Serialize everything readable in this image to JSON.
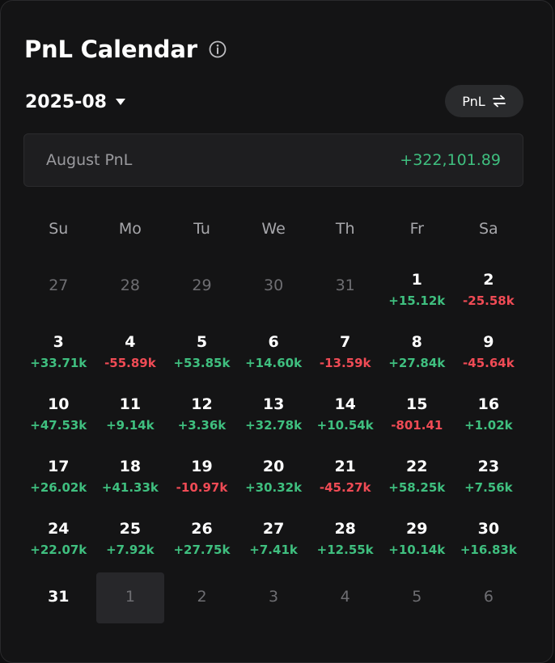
{
  "header": {
    "title": "PnL Calendar",
    "info_icon": "info-icon"
  },
  "month_select": {
    "label": "2025-08",
    "icon": "caret-down-icon"
  },
  "toggle": {
    "label": "PnL",
    "icon": "swap-icon"
  },
  "summary": {
    "label": "August PnL",
    "value": "+322,101.89"
  },
  "colors": {
    "positive": "#3fbf7f",
    "negative": "#f04b55",
    "background": "#141415"
  },
  "weekdays": [
    "Su",
    "Mo",
    "Tu",
    "We",
    "Th",
    "Fr",
    "Sa"
  ],
  "weeks": [
    [
      {
        "day": "27",
        "outside": true
      },
      {
        "day": "28",
        "outside": true
      },
      {
        "day": "29",
        "outside": true
      },
      {
        "day": "30",
        "outside": true
      },
      {
        "day": "31",
        "outside": true
      },
      {
        "day": "1",
        "pnl": "+15.12k",
        "sign": "pos"
      },
      {
        "day": "2",
        "pnl": "-25.58k",
        "sign": "neg"
      }
    ],
    [
      {
        "day": "3",
        "pnl": "+33.71k",
        "sign": "pos"
      },
      {
        "day": "4",
        "pnl": "-55.89k",
        "sign": "neg"
      },
      {
        "day": "5",
        "pnl": "+53.85k",
        "sign": "pos"
      },
      {
        "day": "6",
        "pnl": "+14.60k",
        "sign": "pos"
      },
      {
        "day": "7",
        "pnl": "-13.59k",
        "sign": "neg"
      },
      {
        "day": "8",
        "pnl": "+27.84k",
        "sign": "pos"
      },
      {
        "day": "9",
        "pnl": "-45.64k",
        "sign": "neg"
      }
    ],
    [
      {
        "day": "10",
        "pnl": "+47.53k",
        "sign": "pos"
      },
      {
        "day": "11",
        "pnl": "+9.14k",
        "sign": "pos"
      },
      {
        "day": "12",
        "pnl": "+3.36k",
        "sign": "pos"
      },
      {
        "day": "13",
        "pnl": "+32.78k",
        "sign": "pos"
      },
      {
        "day": "14",
        "pnl": "+10.54k",
        "sign": "pos"
      },
      {
        "day": "15",
        "pnl": "-801.41",
        "sign": "neg"
      },
      {
        "day": "16",
        "pnl": "+1.02k",
        "sign": "pos"
      }
    ],
    [
      {
        "day": "17",
        "pnl": "+26.02k",
        "sign": "pos"
      },
      {
        "day": "18",
        "pnl": "+41.33k",
        "sign": "pos"
      },
      {
        "day": "19",
        "pnl": "-10.97k",
        "sign": "neg"
      },
      {
        "day": "20",
        "pnl": "+30.32k",
        "sign": "pos"
      },
      {
        "day": "21",
        "pnl": "-45.27k",
        "sign": "neg"
      },
      {
        "day": "22",
        "pnl": "+58.25k",
        "sign": "pos"
      },
      {
        "day": "23",
        "pnl": "+7.56k",
        "sign": "pos"
      }
    ],
    [
      {
        "day": "24",
        "pnl": "+22.07k",
        "sign": "pos"
      },
      {
        "day": "25",
        "pnl": "+7.92k",
        "sign": "pos"
      },
      {
        "day": "26",
        "pnl": "+27.75k",
        "sign": "pos"
      },
      {
        "day": "27",
        "pnl": "+7.41k",
        "sign": "pos"
      },
      {
        "day": "28",
        "pnl": "+12.55k",
        "sign": "pos"
      },
      {
        "day": "29",
        "pnl": "+10.14k",
        "sign": "pos"
      },
      {
        "day": "30",
        "pnl": "+16.83k",
        "sign": "pos"
      }
    ],
    [
      {
        "day": "31"
      },
      {
        "day": "1",
        "outside": true,
        "highlight": true
      },
      {
        "day": "2",
        "outside": true
      },
      {
        "day": "3",
        "outside": true
      },
      {
        "day": "4",
        "outside": true
      },
      {
        "day": "5",
        "outside": true
      },
      {
        "day": "6",
        "outside": true
      }
    ]
  ]
}
